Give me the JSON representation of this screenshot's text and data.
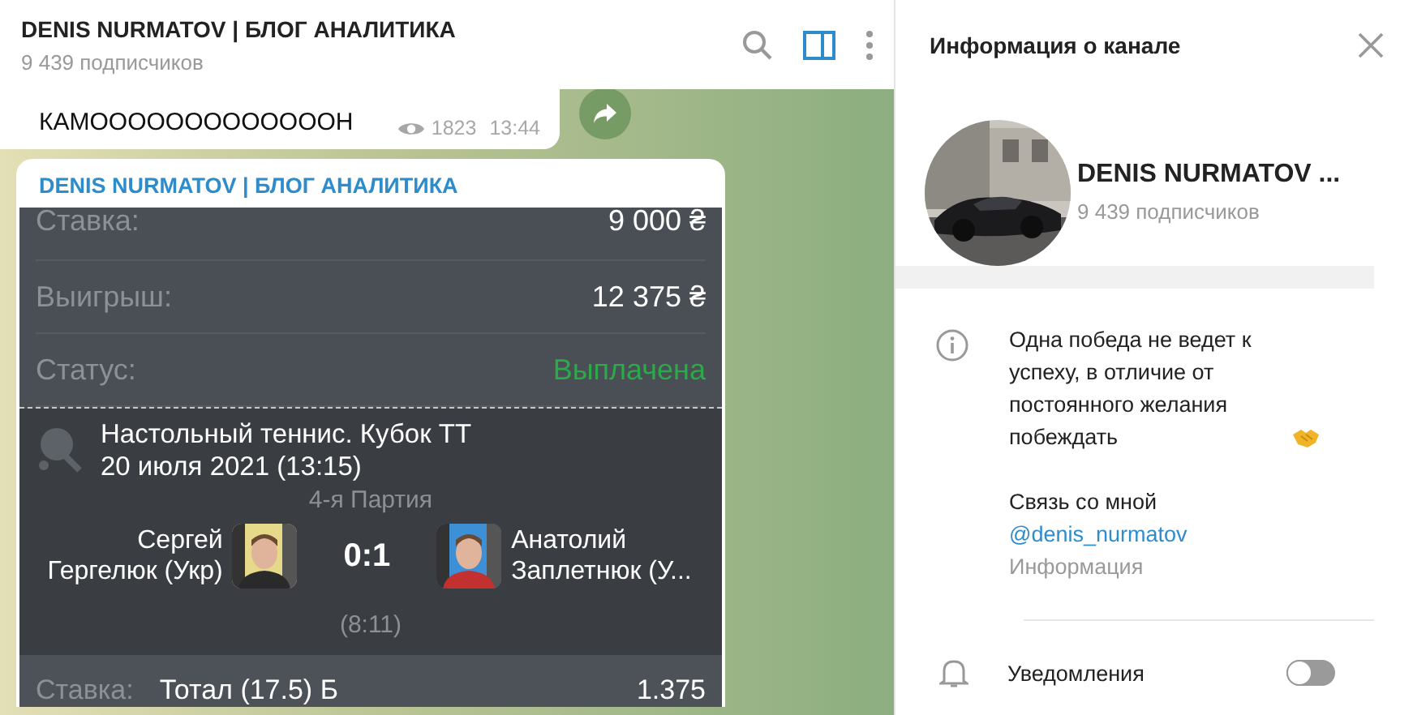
{
  "chat_header": {
    "title": "DENIS NURMATOV | БЛОГ АНАЛИТИКА",
    "subtitle": "9 439 подписчиков",
    "side_panel_open": true
  },
  "messages": [
    {
      "kind": "text",
      "text": "КАМОООООООООООООН",
      "views": "1823",
      "time": "13:44"
    },
    {
      "kind": "bet",
      "author": "DENIS NURMATOV | БЛОГ АНАЛИТИКА",
      "rows": [
        {
          "kind": "amount",
          "label": "Ставка:",
          "value": "9 000 ₴"
        },
        {
          "kind": "amount",
          "label": "Выигрыш:",
          "value": "12 375 ₴"
        },
        {
          "kind": "status",
          "label": "Статус:",
          "value": "Выплачена"
        }
      ],
      "event": {
        "title": "Настольный теннис. Кубок ТТ",
        "date": "20 июля 2021 (13:15)",
        "period": "4-я Партия",
        "player_1": "Сергей Гергелюк (Укр)",
        "player_2": "Анатолий Заплетнюк (У...",
        "score": "0:1",
        "set_score": "(8:11)"
      },
      "pick": {
        "label": "Ставка:",
        "selection": "Тотал (17.5) Б",
        "odds": "1.375"
      }
    }
  ],
  "info_panel": {
    "title": "Информация о канале",
    "channel_name": "DENIS NURMATOV ...",
    "subscribers": "9 439 подписчиков",
    "description": "Одна победа не ведет к успеху, в отличие от постоянного желания побеждать",
    "contact_label": "Связь со мной",
    "link": "@denis_nurmatov",
    "caption": "Информация",
    "notifications_label": "Уведомления",
    "notifications_on": false
  }
}
